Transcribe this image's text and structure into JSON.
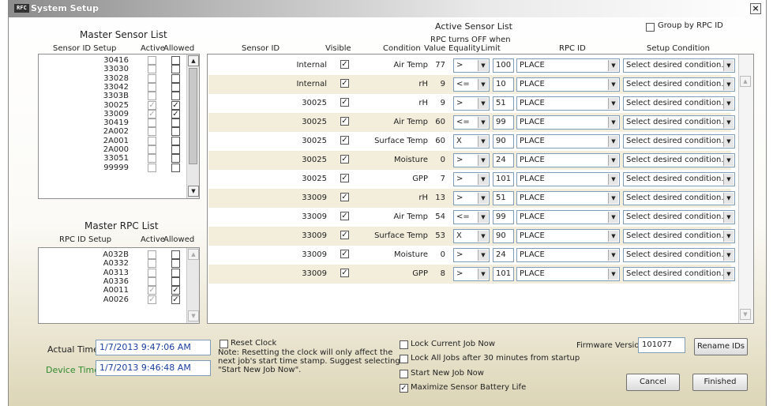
{
  "window": {
    "title": "System Setup",
    "app_icon_text": "RFC",
    "close_glyph": "×"
  },
  "master_sensor": {
    "title": "Master Sensor List",
    "headers": {
      "id": "Sensor ID Setup",
      "active": "Active",
      "allowed": "Allowed"
    },
    "items": [
      {
        "id": "30416",
        "active": false,
        "allowed": false
      },
      {
        "id": "33030",
        "active": false,
        "allowed": false
      },
      {
        "id": "33028",
        "active": false,
        "allowed": false
      },
      {
        "id": "33042",
        "active": false,
        "allowed": false
      },
      {
        "id": "3303B",
        "active": false,
        "allowed": false
      },
      {
        "id": "30025",
        "active": true,
        "allowed": true
      },
      {
        "id": "33009",
        "active": true,
        "allowed": true
      },
      {
        "id": "30419",
        "active": false,
        "allowed": false
      },
      {
        "id": "2A002",
        "active": false,
        "allowed": false
      },
      {
        "id": "2A001",
        "active": false,
        "allowed": false
      },
      {
        "id": "2A000",
        "active": false,
        "allowed": false
      },
      {
        "id": "33051",
        "active": false,
        "allowed": false
      },
      {
        "id": "99999",
        "active": false,
        "allowed": false
      }
    ]
  },
  "master_rpc": {
    "title": "Master RPC List",
    "headers": {
      "id": "RPC ID Setup",
      "active": "Active",
      "allowed": "Allowed"
    },
    "items": [
      {
        "id": "A032B",
        "active": false,
        "allowed": false
      },
      {
        "id": "A0332",
        "active": false,
        "allowed": false
      },
      {
        "id": "A0313",
        "active": false,
        "allowed": false
      },
      {
        "id": "A0336",
        "active": false,
        "allowed": false
      },
      {
        "id": "A0011",
        "active": true,
        "allowed": true
      },
      {
        "id": "A0026",
        "active": true,
        "allowed": true
      }
    ]
  },
  "active_sensor": {
    "title": "Active Sensor List",
    "group_by_label": "Group by RPC ID",
    "group_by_checked": false,
    "rpc_turns_off": "RPC turns OFF when",
    "headers": {
      "sensor_id": "Sensor ID",
      "visible": "Visible",
      "condition": "Condition",
      "value": "Value",
      "equality": "Equality",
      "limit": "Limit",
      "rpc_id": "RPC ID",
      "setup_condition": "Setup Condition"
    },
    "rows": [
      {
        "sensor_id": "Internal",
        "visible": true,
        "condition": "Air Temp",
        "value": "77",
        "equality": ">",
        "limit": "100",
        "rpc_id": "PLACE",
        "setup": "Select desired condition..."
      },
      {
        "sensor_id": "Internal",
        "visible": true,
        "condition": "rH",
        "value": "9",
        "equality": "<=",
        "limit": "10",
        "rpc_id": "PLACE",
        "setup": "Select desired condition..."
      },
      {
        "sensor_id": "30025",
        "visible": true,
        "condition": "rH",
        "value": "9",
        "equality": ">",
        "limit": "51",
        "rpc_id": "PLACE",
        "setup": "Select desired condition..."
      },
      {
        "sensor_id": "30025",
        "visible": true,
        "condition": "Air Temp",
        "value": "60",
        "equality": "<=",
        "limit": "99",
        "rpc_id": "PLACE",
        "setup": "Select desired condition..."
      },
      {
        "sensor_id": "30025",
        "visible": true,
        "condition": "Surface Temp",
        "value": "60",
        "equality": "X",
        "limit": "90",
        "rpc_id": "PLACE",
        "setup": "Select desired condition..."
      },
      {
        "sensor_id": "30025",
        "visible": true,
        "condition": "Moisture",
        "value": "0",
        "equality": ">",
        "limit": "24",
        "rpc_id": "PLACE",
        "setup": "Select desired condition..."
      },
      {
        "sensor_id": "30025",
        "visible": true,
        "condition": "GPP",
        "value": "7",
        "equality": ">",
        "limit": "101",
        "rpc_id": "PLACE",
        "setup": "Select desired condition..."
      },
      {
        "sensor_id": "33009",
        "visible": true,
        "condition": "rH",
        "value": "13",
        "equality": ">",
        "limit": "51",
        "rpc_id": "PLACE",
        "setup": "Select desired condition..."
      },
      {
        "sensor_id": "33009",
        "visible": true,
        "condition": "Air Temp",
        "value": "54",
        "equality": "<=",
        "limit": "99",
        "rpc_id": "PLACE",
        "setup": "Select desired condition..."
      },
      {
        "sensor_id": "33009",
        "visible": true,
        "condition": "Surface Temp",
        "value": "53",
        "equality": "X",
        "limit": "90",
        "rpc_id": "PLACE",
        "setup": "Select desired condition..."
      },
      {
        "sensor_id": "33009",
        "visible": true,
        "condition": "Moisture",
        "value": "0",
        "equality": ">",
        "limit": "24",
        "rpc_id": "PLACE",
        "setup": "Select desired condition..."
      },
      {
        "sensor_id": "33009",
        "visible": true,
        "condition": "GPP",
        "value": "8",
        "equality": ">",
        "limit": "101",
        "rpc_id": "PLACE",
        "setup": "Select desired condition..."
      }
    ]
  },
  "bottom": {
    "actual_time_label": "Actual Time:",
    "actual_time": "1/7/2013 9:47:06 AM",
    "device_time_label": "Device Time:",
    "device_time": "1/7/2013 9:46:48 AM",
    "reset_clock_label": "Reset Clock",
    "reset_clock_checked": false,
    "reset_note": "Note: Resetting the clock will only affect the next job's start time stamp. Suggest selecting \"Start New Job Now\".",
    "lock_current_label": "Lock Current Job Now",
    "lock_current_checked": false,
    "lock_all_label": "Lock All Jobs after 30 minutes from startup",
    "lock_all_checked": false,
    "start_new_label": "Start New Job Now",
    "start_new_checked": false,
    "maximize_label": "Maximize Sensor Battery Life",
    "maximize_checked": true,
    "firmware_label": "Firmware Version",
    "firmware_value": "101077",
    "rename_label": "Rename IDs",
    "cancel_label": "Cancel",
    "finished_label": "Finished"
  },
  "glyphs": {
    "check": "✓",
    "down": "▼",
    "up": "▲"
  },
  "colors": {
    "device_time_label": "#2e8b2e",
    "time_text": "#1a3fa0",
    "row_alt": "#f2eedb"
  }
}
